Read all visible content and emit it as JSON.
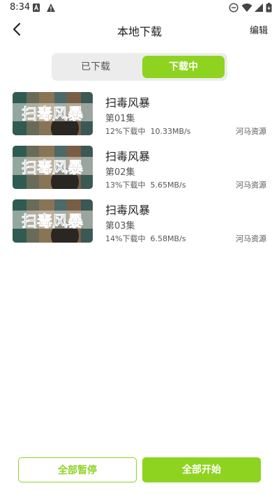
{
  "status_bar": {
    "time": "8:34"
  },
  "header": {
    "title": "本地下载",
    "edit_label": "编辑"
  },
  "tabs": [
    {
      "label": "已下载",
      "active": false
    },
    {
      "label": "下载中",
      "active": true
    }
  ],
  "downloads": [
    {
      "title": "扫毒风暴",
      "episode": "第01集",
      "progress_text": "12%下载中",
      "speed": "10.33MB/s",
      "source": "河马资源"
    },
    {
      "title": "扫毒风暴",
      "episode": "第02集",
      "progress_text": "13%下载中",
      "speed": "5.65MB/s",
      "source": "河马资源"
    },
    {
      "title": "扫毒风暴",
      "episode": "第03集",
      "progress_text": "14%下载中",
      "speed": "6.58MB/s",
      "source": "河马资源"
    }
  ],
  "footer": {
    "pause_all_label": "全部暂停",
    "start_all_label": "全部开始"
  },
  "colors": {
    "accent": "#8ed320"
  }
}
